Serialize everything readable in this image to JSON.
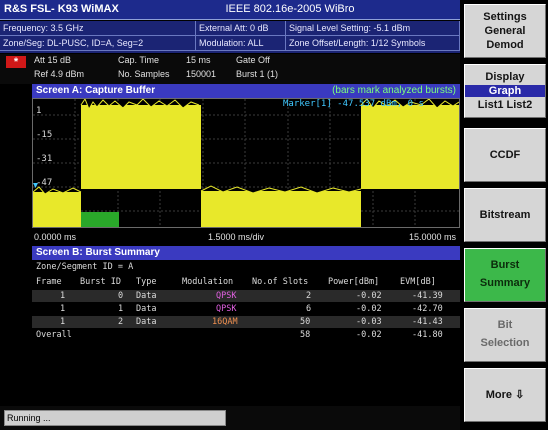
{
  "title": {
    "instrument": "R&S FSL- K93  WiMAX",
    "standard": "IEEE 802.16e-2005 WiBro"
  },
  "info": {
    "frequency": "Frequency: 3.5 GHz",
    "external_att": "External Att: 0 dB",
    "signal_level": "Signal Level Setting: -5.1 dBm",
    "zone_seg": "Zone/Seg: DL-PUSC, ID=A, Seg=2",
    "modulation": "Modulation: ALL",
    "zone_offset": "Zone Offset/Length: 1/12 Symbols"
  },
  "params": {
    "att": "Att    15 dB",
    "ref": "Ref  4.9 dBm",
    "cap_time_label": "Cap. Time",
    "cap_time_val": "15 ms",
    "samples_label": "No. Samples",
    "samples_val": "150001",
    "gate": "Gate Off",
    "burst": "Burst 1 (1)"
  },
  "screen_a": {
    "title": "Screen A: Capture Buffer",
    "note": "(bars mark analyzed bursts)",
    "marker": "Marker[1]  -47.537 dBm, 0 s",
    "y_ticks": [
      "1",
      "-15",
      "-31",
      "-47"
    ],
    "x_start": "0.0000 ms",
    "x_div": "1.5000 ms/div",
    "x_end": "15.0000 ms"
  },
  "screen_b": {
    "title": "Screen B: Burst Summary",
    "zone": "Zone/Segment ID = A",
    "columns": [
      "Frame",
      "Burst ID",
      "Type",
      "Modulation",
      "No.of Slots",
      "Power[dBm]",
      "EVM[dB]"
    ],
    "rows": [
      [
        "1",
        "0",
        "Data",
        "QPSK",
        "2",
        "-0.02",
        "-41.39"
      ],
      [
        "1",
        "1",
        "Data",
        "QPSK",
        "6",
        "-0.02",
        "-42.70"
      ],
      [
        "1",
        "2",
        "Data",
        "16QAM",
        "50",
        "-0.03",
        "-41.43"
      ]
    ],
    "overall": [
      "Overall",
      "58",
      "-0.02",
      "-41.80"
    ]
  },
  "status": "Running ...",
  "softkeys": {
    "settings": [
      "Settings",
      "General",
      "Demod"
    ],
    "display": [
      "Display",
      "Graph",
      "List1 List2"
    ],
    "ccdf": "CCDF",
    "bitstream": "Bitstream",
    "burst_summary": [
      "Burst",
      "Summary"
    ],
    "bit_selection": [
      "Bit",
      "Selection"
    ],
    "more": "More"
  },
  "colors": {
    "header_blue": "#3a3ac0",
    "trace_yellow": "#e8e82a",
    "bar_green": "#2aa82a",
    "marker_cyan": "#40c8ff"
  },
  "icons": {
    "more": "down-arrow-icon"
  }
}
